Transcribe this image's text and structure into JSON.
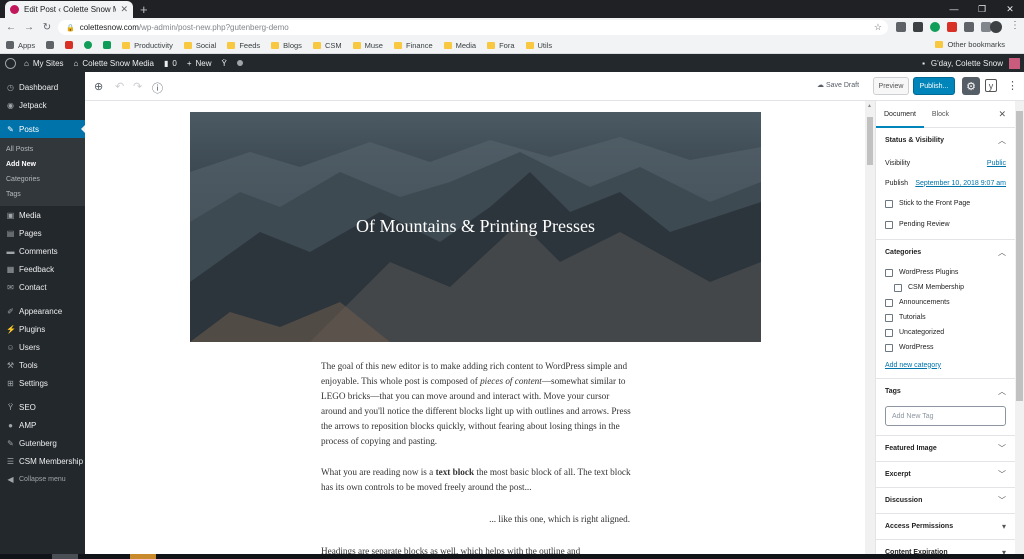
{
  "browser": {
    "tab_title": "Edit Post ‹ Colette Snow Media — ...",
    "url_host": "colettesnow.com",
    "url_path": "/wp-admin/post-new.php?gutenberg-demo",
    "bookmarks": [
      "Apps",
      "Productivity",
      "Social",
      "Feeds",
      "Blogs",
      "CSM",
      "Muse",
      "Finance",
      "Media",
      "Fora",
      "Utils"
    ],
    "other_bookmarks": "Other bookmarks"
  },
  "adminbar": {
    "my_sites": "My Sites",
    "site_name": "Colette Snow Media",
    "comments_count": "0",
    "new_label": "New",
    "greeting": "G'day, Colette Snow"
  },
  "sidebar": {
    "items": [
      {
        "label": "Dashboard",
        "icon": "dashboard-icon"
      },
      {
        "label": "Jetpack",
        "icon": "jetpack-icon"
      },
      {
        "label": "Posts",
        "icon": "pin-icon"
      },
      {
        "label": "Media",
        "icon": "media-icon"
      },
      {
        "label": "Pages",
        "icon": "page-icon"
      },
      {
        "label": "Comments",
        "icon": "comment-icon"
      },
      {
        "label": "Feedback",
        "icon": "feedback-icon"
      },
      {
        "label": "Contact",
        "icon": "contact-icon"
      },
      {
        "label": "Appearance",
        "icon": "brush-icon"
      },
      {
        "label": "Plugins",
        "icon": "plugin-icon"
      },
      {
        "label": "Users",
        "icon": "users-icon"
      },
      {
        "label": "Tools",
        "icon": "wrench-icon"
      },
      {
        "label": "Settings",
        "icon": "settings-icon"
      },
      {
        "label": "SEO",
        "icon": "yoast-icon"
      },
      {
        "label": "AMP",
        "icon": "amp-icon"
      },
      {
        "label": "Gutenberg",
        "icon": "pencil-icon"
      },
      {
        "label": "CSM Membership",
        "icon": "membership-icon"
      }
    ],
    "posts_submenu": [
      "All Posts",
      "Add New",
      "Categories",
      "Tags"
    ],
    "collapse": "Collapse menu"
  },
  "toolbar": {
    "save_draft": "Save Draft",
    "preview": "Preview",
    "publish": "Publish..."
  },
  "content": {
    "cover_title": "Of Mountains & Printing Presses",
    "p1_a": "The goal of this new editor is to make adding rich content to WordPress simple and enjoyable. This whole post is composed of ",
    "p1_em": "pieces of content",
    "p1_b": "—somewhat similar to LEGO bricks—that you can move around and interact with. Move your cursor around and you'll notice the different blocks light up with outlines and arrows. Press the arrows to reposition blocks quickly, without fearing about losing things in the process of copying and pasting.",
    "p2_a": "What you are reading now is a ",
    "p2_b": "text block",
    "p2_c": " the most basic block of all. The text block has its own controls to be moved freely around the post...",
    "p3": "... like this one, which is right aligned.",
    "p4": "Headings are separate blocks as well, which helps with the outline and"
  },
  "settings_sidebar": {
    "tab_document": "Document",
    "tab_block": "Block",
    "status_title": "Status & Visibility",
    "visibility_label": "Visibility",
    "visibility_value": "Public",
    "publish_label": "Publish",
    "publish_value": "September 10, 2018 9:07 am",
    "stick_label": "Stick to the Front Page",
    "pending_label": "Pending Review",
    "categories_title": "Categories",
    "categories": [
      "WordPress Plugins",
      "CSM Membership",
      "Announcements",
      "Tutorials",
      "Uncategorized",
      "WordPress"
    ],
    "add_category": "Add new category",
    "tags_title": "Tags",
    "tag_placeholder": "Add New Tag",
    "featured_image": "Featured Image",
    "excerpt": "Excerpt",
    "discussion": "Discussion",
    "access_permissions": "Access Permissions",
    "content_expiration": "Content Expiration"
  },
  "colors": {
    "admin_dark": "#23282d",
    "wp_blue": "#0073aa",
    "publish_blue": "#0085ba"
  }
}
